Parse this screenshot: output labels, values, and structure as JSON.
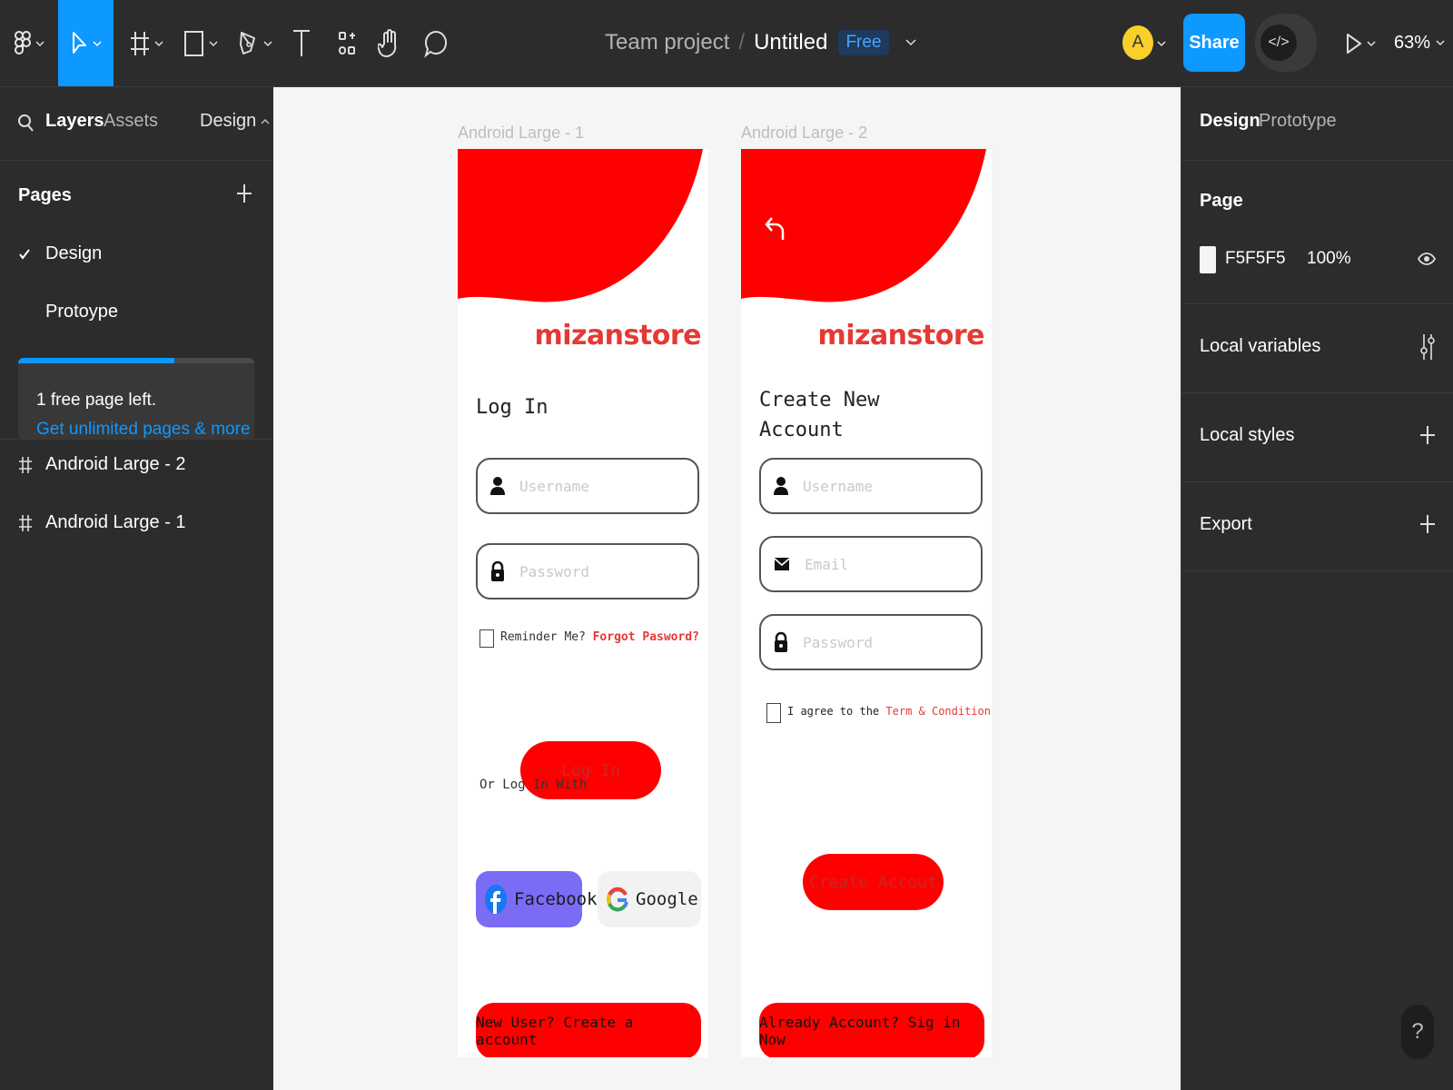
{
  "toolbar": {
    "icons": [
      "figma-menu-icon",
      "move-tool-icon",
      "frame-tool-icon",
      "shape-tool-icon",
      "pen-tool-icon",
      "text-tool-icon",
      "components-icon",
      "hand-tool-icon",
      "comment-tool-icon"
    ],
    "team": "Team project",
    "separator": "/",
    "file_title": "Untitled",
    "plan_badge": "Free",
    "avatar_initial": "A",
    "share_label": "Share",
    "dev_mode_glyph": "</>",
    "zoom": "63%",
    "accent": "#0d99ff"
  },
  "left_panel": {
    "tabs": {
      "layers": "Layers",
      "assets": "Assets",
      "page_menu": "Design"
    },
    "pages_title": "Pages",
    "pages": [
      {
        "label": "Design",
        "selected": true
      },
      {
        "label": "Protoype",
        "selected": false
      }
    ],
    "upgrade": {
      "message": "1 free page left.",
      "link": "Get unlimited pages & more",
      "progress": 0.66
    },
    "layers": [
      {
        "label": "Android Large - 2"
      },
      {
        "label": "Android Large - 1"
      }
    ]
  },
  "canvas": {
    "background": "#F5F5F5",
    "frames": [
      {
        "label": "Android Large - 1",
        "brand": "mizanstore",
        "title": "Log In",
        "username_placeholder": "Username",
        "password_placeholder": "Password",
        "remember": "Reminder Me?",
        "forgot": "Forgot Pasword?",
        "login_button": "Log In",
        "or_login_with": "Or Log In With",
        "facebook": "Facebook",
        "google": "Google",
        "bottom_button": "New User? Create a account"
      },
      {
        "label": "Android Large - 2",
        "brand": "mizanstore",
        "title_line1": "Create New",
        "title_line2": "Account",
        "username_placeholder": "Username",
        "email_placeholder": "Email",
        "password_placeholder": "Password",
        "agree_prefix": "I agree to the",
        "agree_link": "Term & Conditions",
        "create_button": "Create Accout",
        "bottom_button": "Already Account? Sig in Now"
      }
    ],
    "brand_red": "#FF0000"
  },
  "right_panel": {
    "tabs": {
      "design": "Design",
      "prototype": "Prototype"
    },
    "page_section": "Page",
    "fill_hex": "F5F5F5",
    "fill_opacity": "100%",
    "local_variables": "Local variables",
    "local_styles": "Local styles",
    "export": "Export"
  },
  "help": "?"
}
